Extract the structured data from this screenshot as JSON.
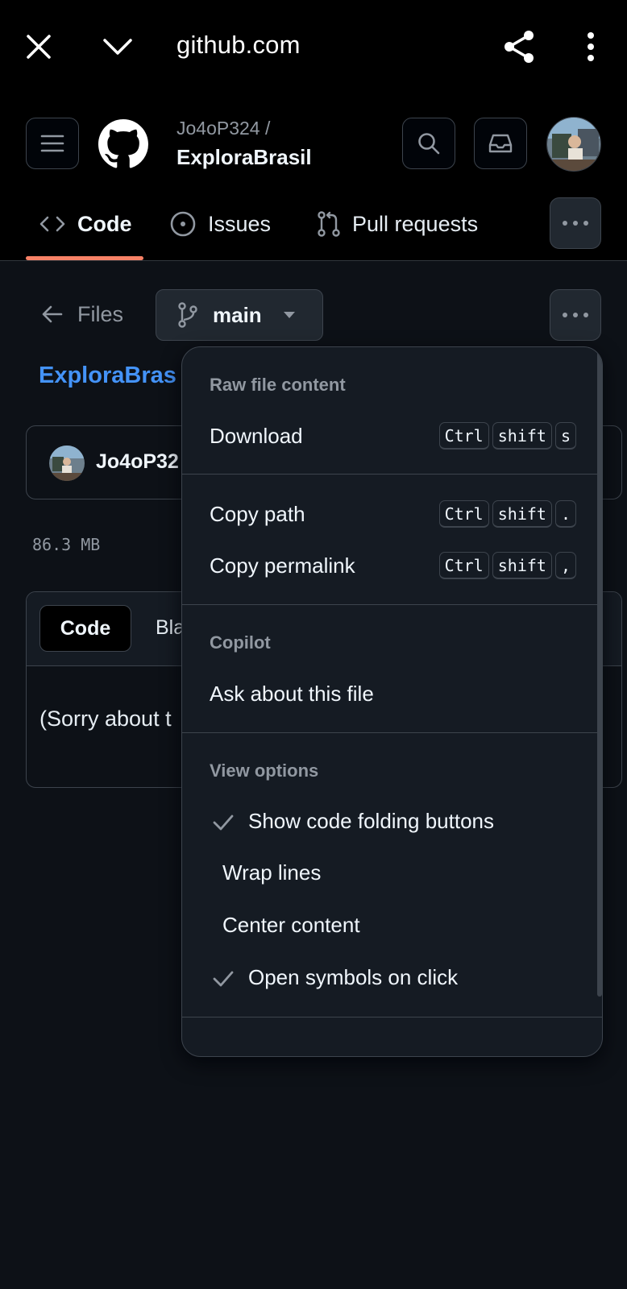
{
  "browser": {
    "url": "github.com"
  },
  "header": {
    "owner": "Jo4oP324 /",
    "repo": "ExploraBrasil"
  },
  "tabs": [
    {
      "label": "Code",
      "selected": true
    },
    {
      "label": "Issues"
    },
    {
      "label": "Pull requests"
    }
  ],
  "toolbar": {
    "files_label": "Files",
    "branch": "main"
  },
  "file": {
    "breadcrumb": "ExploraBras",
    "commit_author": "Jo4oP32",
    "size": "86.3 MB",
    "view_tabs": [
      "Code",
      "Bla"
    ],
    "content_preview": "(Sorry about t"
  },
  "menu": {
    "raw_group": "Raw file content",
    "download": {
      "label": "Download",
      "keys": [
        "Ctrl",
        "shift",
        "s"
      ]
    },
    "copy_path": {
      "label": "Copy path",
      "keys": [
        "Ctrl",
        "shift",
        "."
      ]
    },
    "copy_permalink": {
      "label": "Copy permalink",
      "keys": [
        "Ctrl",
        "shift",
        ","
      ]
    },
    "copilot_group": "Copilot",
    "ask_file": "Ask about this file",
    "view_group": "View options",
    "view_options": [
      {
        "label": "Show code folding buttons",
        "checked": true
      },
      {
        "label": "Wrap lines",
        "checked": false
      },
      {
        "label": "Center content",
        "checked": false
      },
      {
        "label": "Open symbols on click",
        "checked": true
      }
    ]
  },
  "colors": {
    "accent_link": "#4493f8",
    "tab_underline": "#f78166",
    "background": "#0d1117"
  }
}
